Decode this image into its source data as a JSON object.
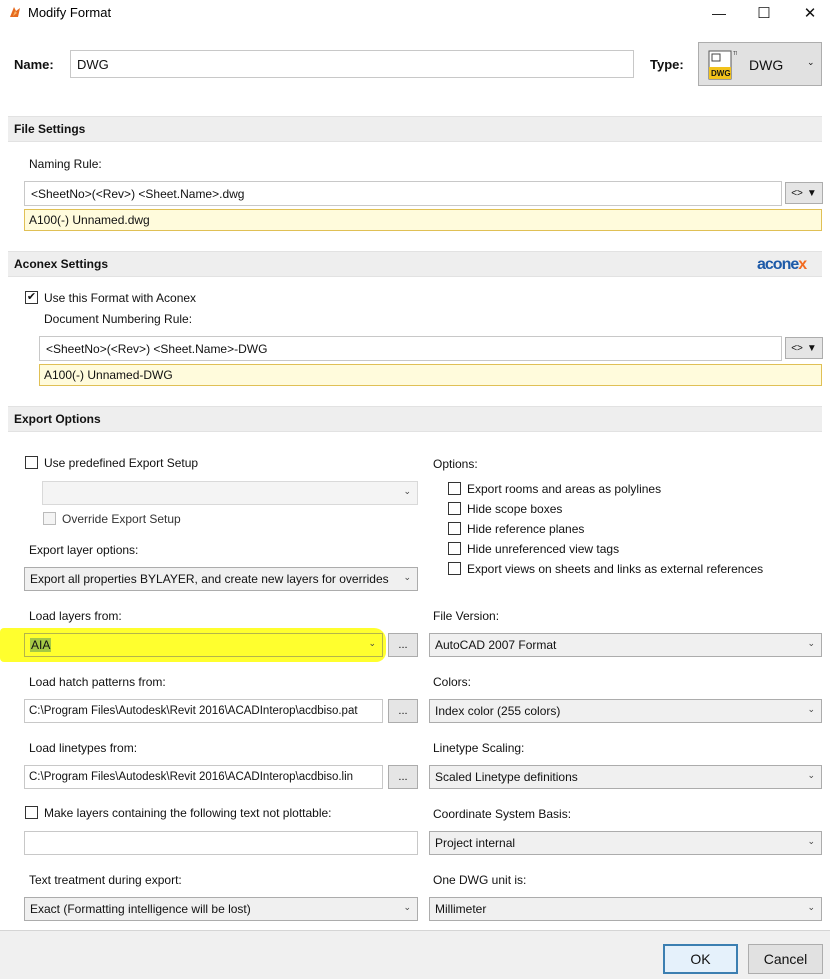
{
  "window": {
    "title": "Modify Format",
    "minimize_glyph": "—",
    "maximize_glyph": "☐",
    "close_glyph": "✕"
  },
  "header": {
    "name_label": "Name:",
    "name_value": "DWG",
    "type_label": "Type:",
    "type_value": "DWG",
    "type_icon_text": "DWG"
  },
  "file_settings": {
    "title": "File Settings",
    "naming_rule_label": "Naming Rule:",
    "naming_rule_value": "<SheetNo>(<Rev>) <Sheet.Name>.dwg",
    "tag_button": "<>",
    "preview": "A100(-) Unnamed.dwg"
  },
  "aconex": {
    "title": "Aconex Settings",
    "logo_text": "aconex",
    "use_format_label": "Use this Format with Aconex",
    "use_format_checked": "✔",
    "numbering_label": "Document Numbering Rule:",
    "numbering_value": "<SheetNo>(<Rev>) <Sheet.Name>-DWG",
    "tag_button": "<>",
    "preview": "A100(-) Unnamed-DWG"
  },
  "export_options": {
    "title": "Export Options",
    "use_predefined_label": "Use predefined Export Setup",
    "predefined_value": "",
    "override_label": "Override Export Setup",
    "export_layer_label": "Export layer options:",
    "export_layer_value": "Export all properties BYLAYER, and create new layers for overrides",
    "options_label": "Options:",
    "options": [
      "Export rooms and areas as polylines",
      "Hide scope boxes",
      "Hide reference planes",
      "Hide unreferenced view tags",
      "Export views on sheets and links as external references"
    ],
    "load_layers_label": "Load layers from:",
    "load_layers_value": "AIA",
    "file_version_label": "File Version:",
    "file_version_value": "AutoCAD 2007 Format",
    "hatch_label": "Load hatch patterns from:",
    "hatch_value": "C:\\Program Files\\Autodesk\\Revit 2016\\ACADInterop\\acdbiso.pat",
    "colors_label": "Colors:",
    "colors_value": "Index color (255 colors)",
    "linetypes_label": "Load linetypes from:",
    "linetypes_value": "C:\\Program Files\\Autodesk\\Revit 2016\\ACADInterop\\acdbiso.lin",
    "linetype_scaling_label": "Linetype Scaling:",
    "linetype_scaling_value": "Scaled Linetype definitions",
    "not_plottable_label": "Make layers containing the following text not plottable:",
    "not_plottable_value": "",
    "coord_label": "Coordinate System Basis:",
    "coord_value": "Project internal",
    "text_treatment_label": "Text treatment during export:",
    "text_treatment_value": "Exact (Formatting intelligence will be lost)",
    "dwg_unit_label": "One DWG unit is:",
    "dwg_unit_value": "Millimeter",
    "browse": "..."
  },
  "footer": {
    "ok": "OK",
    "cancel": "Cancel"
  },
  "colors": {
    "highlight": "#ffff2e",
    "preview_bg": "#fffbdc",
    "aconex_blue": "#1d5aa8",
    "aconex_orange": "#f26b21"
  }
}
